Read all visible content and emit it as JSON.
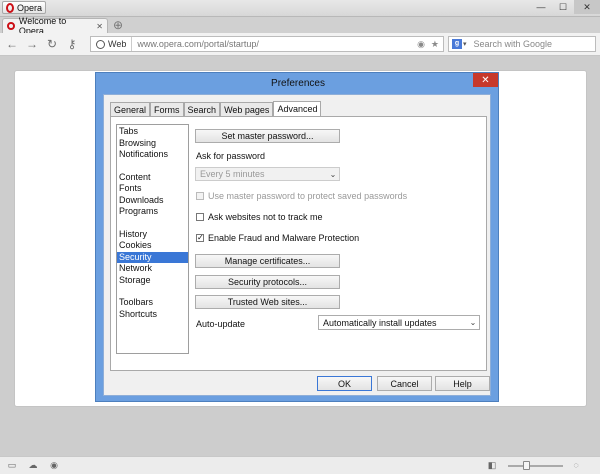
{
  "browser": {
    "menu_label": "Opera",
    "tab_title": "Welcome to Opera",
    "address_chip": "Web",
    "url": "www.opera.com/portal/startup/",
    "search_placeholder": "Search with Google",
    "icons": {
      "back": "back-arrow-icon",
      "forward": "forward-arrow-icon",
      "reload": "reload-icon",
      "key": "key-icon",
      "rss": "rss-icon",
      "bookmark": "star-icon",
      "search_engine": "google-icon"
    }
  },
  "dialog": {
    "title": "Preferences",
    "tabs": [
      {
        "label": "General"
      },
      {
        "label": "Forms"
      },
      {
        "label": "Search"
      },
      {
        "label": "Web pages"
      },
      {
        "label": "Advanced",
        "active": true
      }
    ],
    "categories": {
      "group1": [
        "Tabs",
        "Browsing",
        "Notifications"
      ],
      "group2": [
        "Content",
        "Fonts",
        "Downloads",
        "Programs"
      ],
      "group3": [
        "History",
        "Cookies",
        "Security",
        "Network",
        "Storage"
      ],
      "group4": [
        "Toolbars",
        "Shortcuts"
      ],
      "selected": "Security"
    },
    "security": {
      "master_password_button": "Set master password...",
      "ask_for_password_label": "Ask for password",
      "ask_for_password_value": "Every 5 minutes",
      "use_master_password_label": "Use master password to protect saved passwords",
      "use_master_password_checked": false,
      "do_not_track_label": "Ask websites not to track me",
      "do_not_track_checked": false,
      "fraud_protection_label": "Enable Fraud and Malware Protection",
      "fraud_protection_checked": true,
      "manage_certificates_button": "Manage certificates...",
      "security_protocols_button": "Security protocols...",
      "trusted_sites_button": "Trusted Web sites...",
      "auto_update_label": "Auto-update",
      "auto_update_value": "Automatically install updates"
    },
    "buttons": {
      "ok": "OK",
      "cancel": "Cancel",
      "help": "Help"
    }
  },
  "colors": {
    "dialog_frame": "#6b9fe0",
    "selection": "#3a77d6",
    "close_button": "#c7392b",
    "opera_red": "#cc0f16"
  }
}
